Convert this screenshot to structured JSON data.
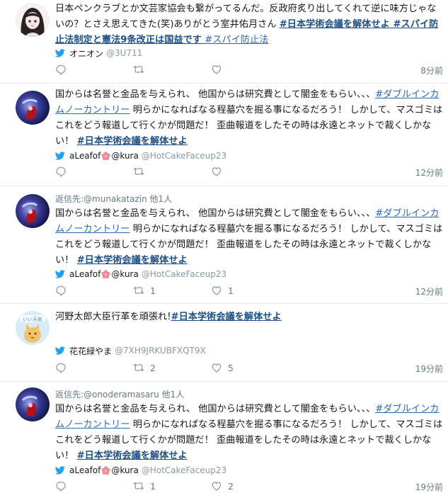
{
  "tweets": [
    {
      "reply_to": "",
      "text_plain": "日本ペンクラブとか文芸家協会も繋がってるんだ。反政府炙り出してくれて逆に味方じゃないの？とさえ思えてきた(笑)ありがとう室井佑月さん ",
      "hashtag1": "#日本学術会議を解体せよ",
      "hashtag2": " #スパイ防止法制定と憲法9条改正は国益です",
      "hashtag3": " #スパイ防止法",
      "name": "オニオン",
      "handle": "@3U711",
      "reply_count": "",
      "retweet_count": "",
      "like_count": "",
      "time": "8分前"
    },
    {
      "reply_to": "",
      "text_a": "国からは名誉と金品を与えられ、 他国からは研究費として闇金をもらい、、、",
      "hashtag_a": "#ダブルインカムノーカントリー",
      "text_b": " 明らかになればなる程墓穴を掘る事になるだろう！ しかして、マスゴミはこれをどう報道して行くかが問題だ！ 歪曲報道をしたその時は永遠とネットで裁くしかない！ ",
      "hashtag_b": "#日本学術会議を解体せよ",
      "name_a": "aLeafof",
      "name_b": "@kura",
      "handle": "@HotCakeFaceup23",
      "reply_count": "",
      "retweet_count": "",
      "like_count": "",
      "time": "12分前"
    },
    {
      "reply_to": "返信先:@munakatazin 他1人",
      "text_a": "国からは名誉と金品を与えられ、 他国からは研究費として闇金をもらい、、、",
      "hashtag_a": "#ダブルインカムノーカントリー",
      "text_b": " 明らかになればなる程墓穴を掘る事になるだろう！ しかして、マスゴミはこれをどう報道して行くかが問題だ！ 歪曲報道をしたその時は永遠とネットで裁くしかない！ ",
      "hashtag_b": "#日本学術会議を解体せよ",
      "name_a": "aLeafof",
      "name_b": "@kura",
      "handle": "@HotCakeFaceup23",
      "reply_count": "",
      "retweet_count": "1",
      "like_count": "1",
      "time": "12分前"
    },
    {
      "reply_to": "",
      "text_plain": "河野太郎大臣行革を頑張れ!",
      "hashtag1": "#日本学術会議を解体せよ",
      "name": "花花緑やま",
      "handle": "@7XH9JRKUBFXQT9X",
      "reply_count": "",
      "retweet_count": "2",
      "like_count": "5",
      "time": "19分前"
    },
    {
      "reply_to": "返信先:@onoderamasaru 他1人",
      "text_a": "国からは名誉と金品を与えられ、 他国からは研究費として闇金をもらい、、、",
      "hashtag_a": "#ダブルインカムノーカントリー",
      "text_b": " 明らかになればなる程墓穴を掘る事になるだろう！ しかして、マスゴミはこれをどう報道して行くかが問題だ！ 歪曲報道をしたその時は永遠とネットで裁くしかない！ ",
      "hashtag_b": "#日本学術会議を解体せよ",
      "name_a": "aLeafof",
      "name_b": "@kura",
      "handle": "@HotCakeFaceup23",
      "reply_count": "",
      "retweet_count": "1",
      "like_count": "2",
      "time": "19分前"
    }
  ],
  "icons": {
    "reply": "reply-icon",
    "retweet": "retweet-icon",
    "like": "heart-icon",
    "twitter": "twitter-bird-icon",
    "flower": "flower-emoji-icon"
  },
  "colors": {
    "hashtag": "#1b4f86",
    "twitter_blue": "#1da1f2",
    "meta_gray": "#657786",
    "icon_gray": "#8899a6",
    "flower_pink": "#e75a86"
  }
}
